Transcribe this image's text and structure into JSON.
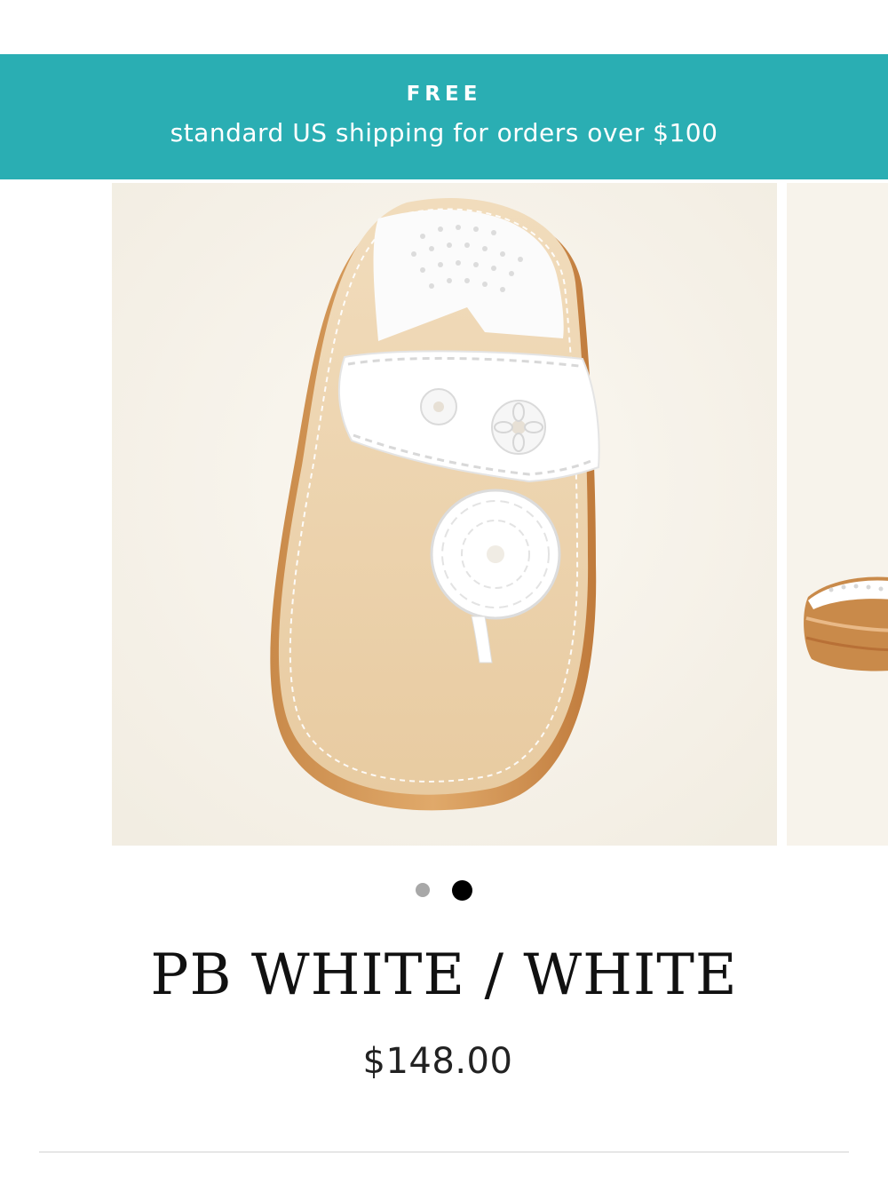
{
  "announcement": {
    "heading": "FREE",
    "body": "standard US shipping for orders over $100",
    "background_color": "#2aaeb3"
  },
  "gallery": {
    "slide_count": 2,
    "active_slide": 2,
    "zoom_icon": "magnifier-icon"
  },
  "product": {
    "title": "PB WHITE / WHITE",
    "price": "$148.00"
  }
}
